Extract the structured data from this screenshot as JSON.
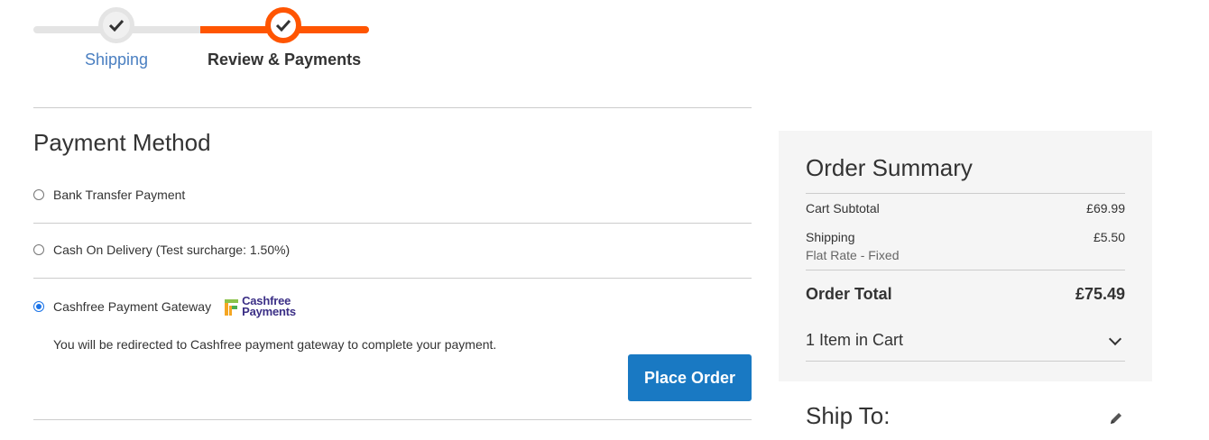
{
  "progress": {
    "steps": [
      {
        "label": "Shipping",
        "state": "complete"
      },
      {
        "label": "Review & Payments",
        "state": "active"
      }
    ],
    "accent_color": "#ff5501",
    "icon": "check-icon"
  },
  "payment": {
    "title": "Payment Method",
    "methods": [
      {
        "label": "Bank Transfer Payment",
        "selected": false
      },
      {
        "label": "Cash On Delivery (Test surcharge: 1.50%)",
        "selected": false
      },
      {
        "label": "Cashfree Payment Gateway",
        "selected": true,
        "logo_text_1": "Cashfree",
        "logo_text_2": "Payments"
      }
    ],
    "redirect_note": "You will be redirected to Cashfree payment gateway to complete your payment.",
    "place_order_label": "Place Order",
    "button_color": "#1979c3"
  },
  "summary": {
    "title": "Order Summary",
    "subtotal_label": "Cart Subtotal",
    "subtotal_value": "£69.99",
    "shipping_label": "Shipping",
    "shipping_method": "Flat Rate - Fixed",
    "shipping_value": "£5.50",
    "total_label": "Order Total",
    "total_value": "£75.49",
    "items_label": "1 Item in Cart"
  },
  "ship_to": {
    "title": "Ship To:",
    "icon": "pencil-icon"
  }
}
